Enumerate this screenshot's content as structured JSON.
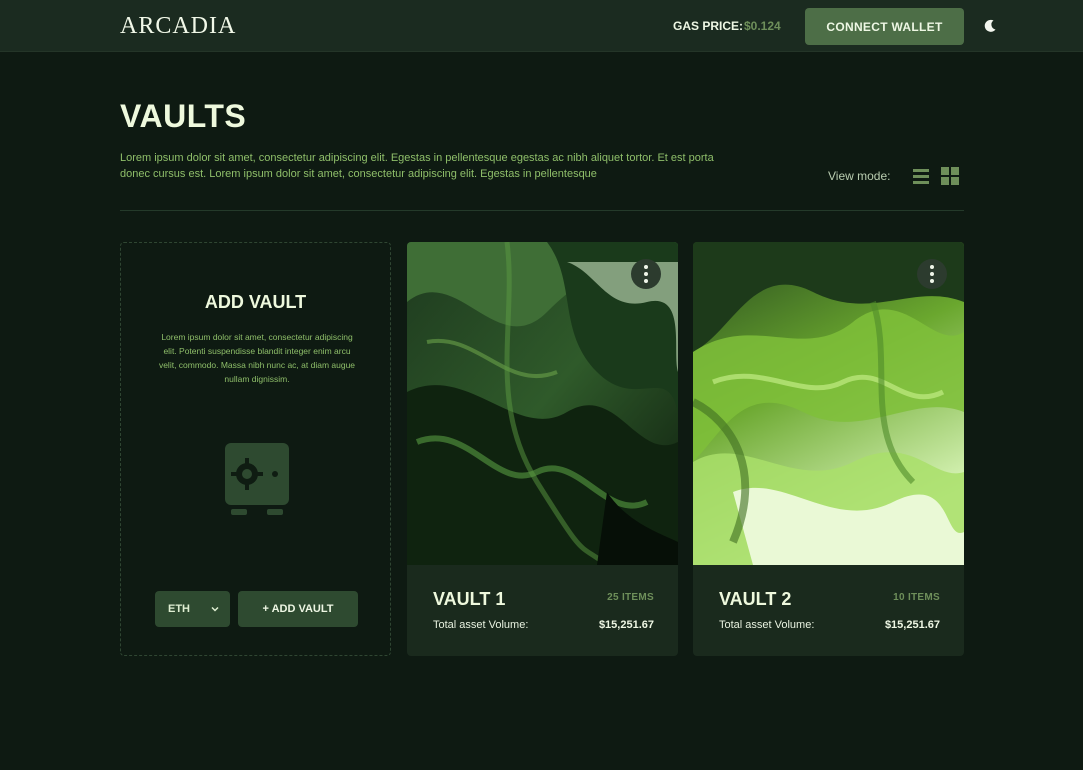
{
  "header": {
    "logo": "ARCADIA",
    "gas_label": "GAS PRICE:",
    "gas_value": "$0.124",
    "connect_label": "CONNECT WALLET",
    "theme_icon": "moon-icon"
  },
  "page": {
    "title": "VAULTS",
    "description": "Lorem ipsum dolor sit amet, consectetur adipiscing elit. Egestas in pellentesque egestas ac nibh aliquet tortor. Et est porta donec cursus est. Lorem ipsum dolor sit amet, consectetur adipiscing elit. Egestas in pellentesque",
    "view_mode_label": "View mode:",
    "view_modes": [
      "list-icon",
      "grid-icon"
    ]
  },
  "add_vault": {
    "title": "ADD VAULT",
    "description": "Lorem ipsum dolor sit amet, consectetur adipiscing elit. Potenti suspendisse blandit integer enim arcu velit, commodo. Massa nibh nunc ac, at diam augue nullam dignissim.",
    "currency": "ETH",
    "button_label": "+ ADD VAULT",
    "icon": "safe-icon"
  },
  "vaults": [
    {
      "name": "VAULT 1",
      "items": "25 ITEMS",
      "volume_label": "Total asset Volume:",
      "volume_value": "$15,251.67"
    },
    {
      "name": "VAULT 2",
      "items": "10 ITEMS",
      "volume_label": "Total asset Volume:",
      "volume_value": "$15,251.67"
    }
  ],
  "colors": {
    "background": "#0e1a12",
    "header": "#1b2b20",
    "accent": "#4d6e47",
    "muted_green": "#6e8f5a",
    "text_green": "#8fbf6a",
    "title": "#eef9dd"
  }
}
